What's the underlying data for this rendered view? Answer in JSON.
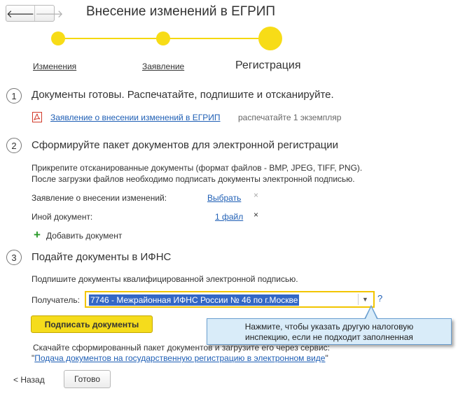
{
  "window": {
    "title": "Внесение изменений в ЕГРИП"
  },
  "nav": {
    "back_glyph": "🡐",
    "forward_glyph": "🡒"
  },
  "steps": [
    {
      "label": "Изменения",
      "state": "done"
    },
    {
      "label": "Заявление",
      "state": "done"
    },
    {
      "label": "Регистрация",
      "state": "current"
    }
  ],
  "section1": {
    "number": "1",
    "heading": "Документы готовы. Распечатайте, подпишите и отсканируйте.",
    "doc_link": "Заявление о внесении изменений в ЕГРИП",
    "doc_note": "распечатайте 1 экземпляр"
  },
  "section2": {
    "number": "2",
    "heading": "Сформируйте пакет документов для электронной регистрации",
    "desc_line1": "Прикрепите отсканированные документы (формат файлов - BMP, JPEG, TIFF, PNG).",
    "desc_line2": "После загрузки файлов необходимо подписать документы электронной подписью.",
    "rows": [
      {
        "label": "Заявление о внесении изменений:",
        "action": "Выбрать",
        "remove": "×"
      },
      {
        "label": "Иной документ:",
        "action": "1 файл",
        "remove": "×"
      }
    ],
    "add_label": "Добавить документ"
  },
  "section3": {
    "number": "3",
    "heading": "Подайте документы в ИФНС",
    "desc": "Подпишите документы квалифицированной электронной подписью.",
    "recipient_label": "Получатель:",
    "recipient_value": "7746 - Межрайонная ИФНС России № 46 по г.Москве",
    "help": "?",
    "sign_button": "Подписать документы",
    "download_text": "Скачайте сформированный пакет документов и загрузите его через сервис:",
    "service_quote_open": "\"",
    "service_link": "Подача документов на государственную регистрацию в электронном виде",
    "service_quote_close": "\""
  },
  "tooltip": {
    "line1": "Нажмите, чтобы указать другую налоговую",
    "line2": "инспекцию, если не подходит заполненная"
  },
  "footer": {
    "back": "< Назад",
    "done": "Готово"
  },
  "colors": {
    "accent": "#f5dc1c",
    "link": "#1f5fb5",
    "selection": "#3367c6",
    "tooltip_bg": "#d9ecf9"
  }
}
